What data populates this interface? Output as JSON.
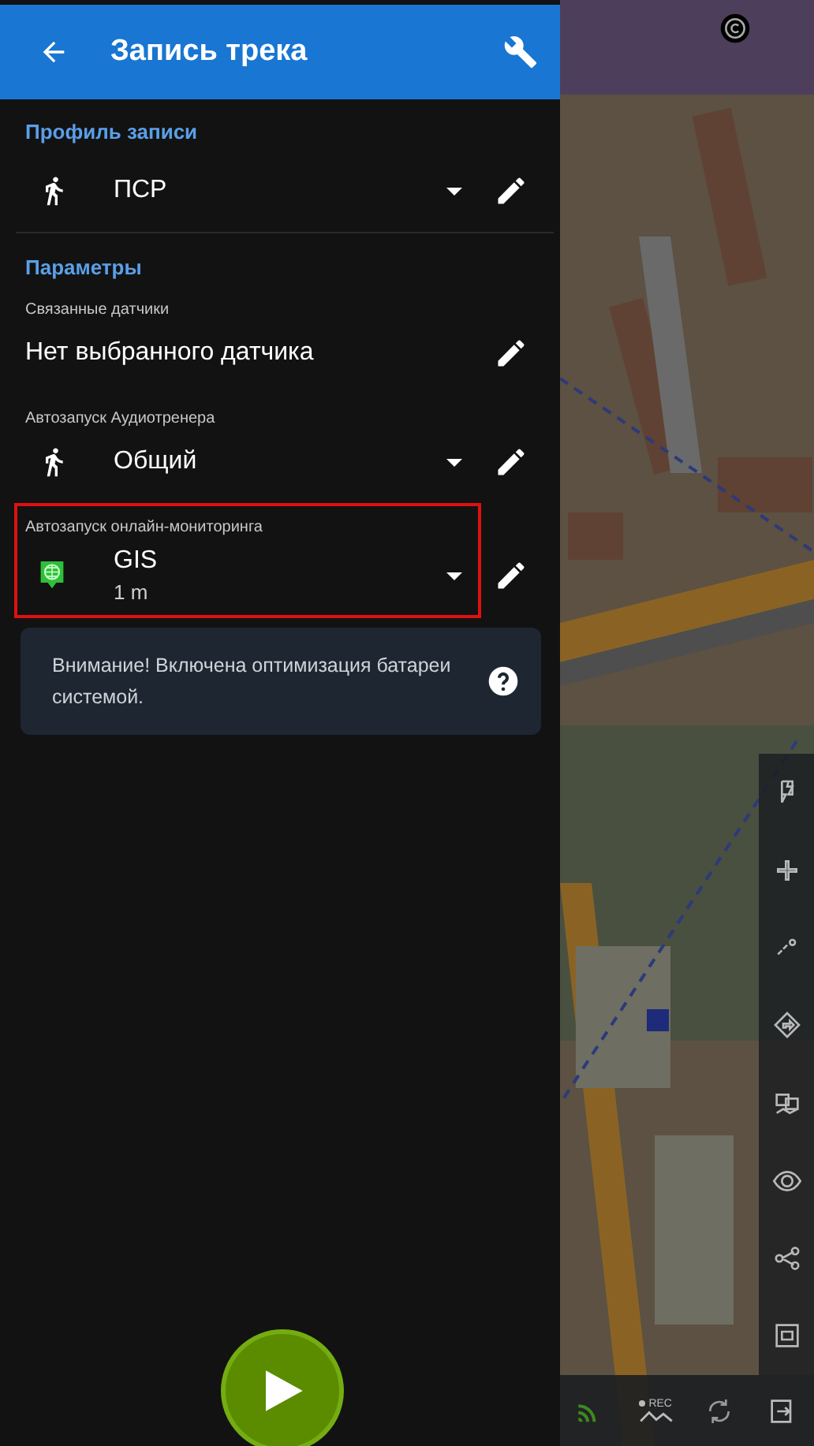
{
  "header": {
    "title": "Запись трека"
  },
  "profile_section": {
    "heading": "Профиль записи",
    "value": "ПСР"
  },
  "params_section": {
    "heading": "Параметры",
    "items": [
      {
        "kind": "sensor",
        "label": "Связанные датчики",
        "value": "Нет выбранного датчика",
        "highlighted": false
      },
      {
        "kind": "trainer",
        "label": "Автозапуск Аудиотренера",
        "value": "Общий",
        "highlighted": false
      },
      {
        "kind": "monitoring",
        "label": "Автозапуск онлайн-мониторинга",
        "value": "GIS",
        "subvalue": "1 m",
        "highlighted": true
      }
    ]
  },
  "notice": {
    "text": "Внимание! Включена оптимизация батареи системой."
  },
  "map": {
    "kind": "picture",
    "bottom_bar": {
      "rec_label": "REC"
    }
  }
}
